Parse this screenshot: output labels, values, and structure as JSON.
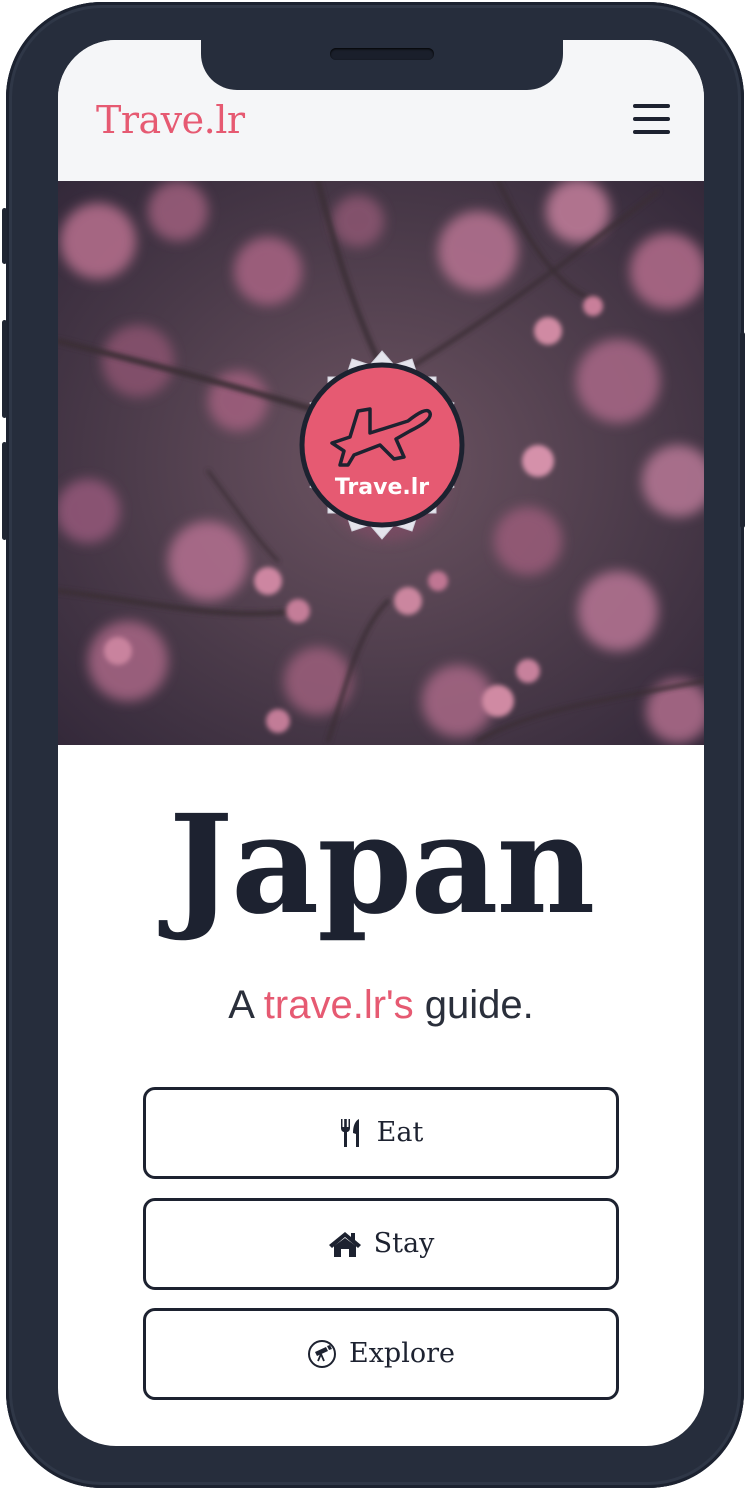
{
  "navbar": {
    "brand": "Trave.lr",
    "menu_icon": "hamburger-menu-icon"
  },
  "hero": {
    "image": "cherry-blossom-branches",
    "logo_text": "Trave.lr",
    "logo_icon": "airplane-icon"
  },
  "main": {
    "title": "Japan",
    "subtitle_prefix": "A ",
    "subtitle_accent": "trave.lr's",
    "subtitle_suffix": " guide."
  },
  "actions": [
    {
      "label": "Eat",
      "icon": "fork-knife-icon"
    },
    {
      "label": "Stay",
      "icon": "home-icon"
    },
    {
      "label": "Explore",
      "icon": "telescope-icon"
    }
  ],
  "colors": {
    "accent": "#e65a72",
    "dark": "#1d2230",
    "device": "#262d3c"
  }
}
